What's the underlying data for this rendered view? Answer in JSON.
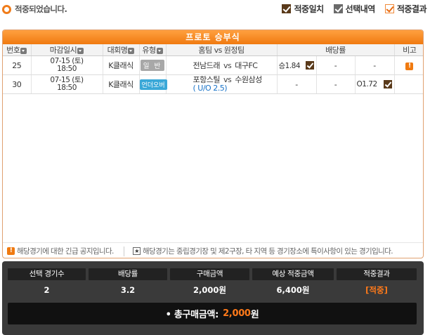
{
  "status": {
    "message": "적중되었습니다."
  },
  "legend": [
    {
      "label": "적중일치"
    },
    {
      "label": "선택내역"
    },
    {
      "label": "적중결과"
    }
  ],
  "panel": {
    "title": "프로토 승부식",
    "headers": {
      "no": "번호",
      "deadline": "마감일시",
      "league": "대회명",
      "type": "유형",
      "match": "홈팀 vs 원정팀",
      "odds": "배당률",
      "note": "비고"
    },
    "rows": [
      {
        "no": "25",
        "date": "07-15 (토)",
        "time": "18:50",
        "league": "K클래식",
        "type": "일 반",
        "home": "전남드래",
        "vs": "vs",
        "away": "대구FC",
        "uo": "",
        "odd1": "승1.84",
        "odd2": "-",
        "odd3": "-",
        "note": "!"
      },
      {
        "no": "30",
        "date": "07-15 (토)",
        "time": "18:50",
        "league": "K클래식",
        "type": "언더오버",
        "home": "포항스틸",
        "vs": "vs",
        "away": "수원삼성",
        "uo": "( U/O 2.5)",
        "odd1": "-",
        "odd2": "-",
        "odd3": "O1.72",
        "note": ""
      }
    ],
    "footer": {
      "notice1": "해당경기에 대한 긴급 공지입니다.",
      "notice2": "해당경기는 중립경기장 및 제2구장, 타 지역 등 경기장소에 특이사항이 있는 경기입니다."
    }
  },
  "summary": {
    "headers": [
      "선택 경기수",
      "배당률",
      "구매금액",
      "예상 적중금액",
      "적중결과"
    ],
    "values": [
      "2",
      "3.2",
      "2,000원",
      "6,400원",
      "[적중]"
    ],
    "total_label": "• 총구매금액:",
    "total_amount": "2,000",
    "total_unit": "원"
  },
  "colors": {
    "accent": "#f07a10",
    "hit": "#5a3a1a",
    "uo": "#1a73c8"
  }
}
